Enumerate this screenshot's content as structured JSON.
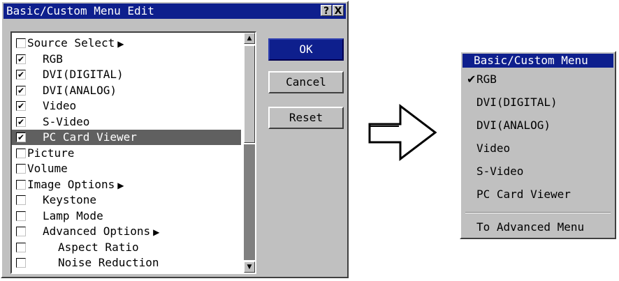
{
  "dialog": {
    "title": "Basic/Custom Menu Edit",
    "help_label": "?",
    "close_label": "X",
    "items": [
      {
        "label": "Source Select",
        "checked": false,
        "indent": 0,
        "submenu": true
      },
      {
        "label": "RGB",
        "checked": true,
        "indent": 1,
        "submenu": false
      },
      {
        "label": "DVI(DIGITAL)",
        "checked": true,
        "indent": 1,
        "submenu": false
      },
      {
        "label": "DVI(ANALOG)",
        "checked": true,
        "indent": 1,
        "submenu": false
      },
      {
        "label": "Video",
        "checked": true,
        "indent": 1,
        "submenu": false
      },
      {
        "label": "S-Video",
        "checked": true,
        "indent": 1,
        "submenu": false
      },
      {
        "label": "PC Card Viewer",
        "checked": true,
        "indent": 1,
        "submenu": false,
        "selected": true
      },
      {
        "label": "Picture",
        "checked": false,
        "indent": 0,
        "submenu": false
      },
      {
        "label": "Volume",
        "checked": false,
        "indent": 0,
        "submenu": false
      },
      {
        "label": "Image Options",
        "checked": false,
        "indent": 0,
        "submenu": true
      },
      {
        "label": "Keystone",
        "checked": false,
        "indent": 1,
        "submenu": false
      },
      {
        "label": "Lamp Mode",
        "checked": false,
        "indent": 1,
        "submenu": false
      },
      {
        "label": "Advanced Options",
        "checked": false,
        "indent": 1,
        "submenu": true
      },
      {
        "label": "Aspect Ratio",
        "checked": false,
        "indent": 2,
        "submenu": false
      },
      {
        "label": "Noise Reduction",
        "checked": false,
        "indent": 2,
        "submenu": false
      }
    ],
    "buttons": {
      "ok": "OK",
      "cancel": "Cancel",
      "reset": "Reset"
    }
  },
  "menu": {
    "title": "Basic/Custom Menu",
    "items": [
      {
        "label": "RGB",
        "checked": true
      },
      {
        "label": "DVI(DIGITAL)",
        "checked": false
      },
      {
        "label": "DVI(ANALOG)",
        "checked": false
      },
      {
        "label": "Video",
        "checked": false
      },
      {
        "label": "S-Video",
        "checked": false
      },
      {
        "label": "PC Card Viewer",
        "checked": false
      }
    ],
    "footer_item": "To Advanced Menu"
  },
  "colors": {
    "title_bar": "#0e1f8d",
    "face": "#c0c0c0",
    "selection": "#606060"
  },
  "icons": {
    "checkbox_check": "check-icon",
    "submenu_arrow": "triangle-right-icon",
    "scroll_up": "scroll-up-icon",
    "scroll_down": "scroll-down-icon",
    "transition_arrow": "right-arrow-icon"
  }
}
